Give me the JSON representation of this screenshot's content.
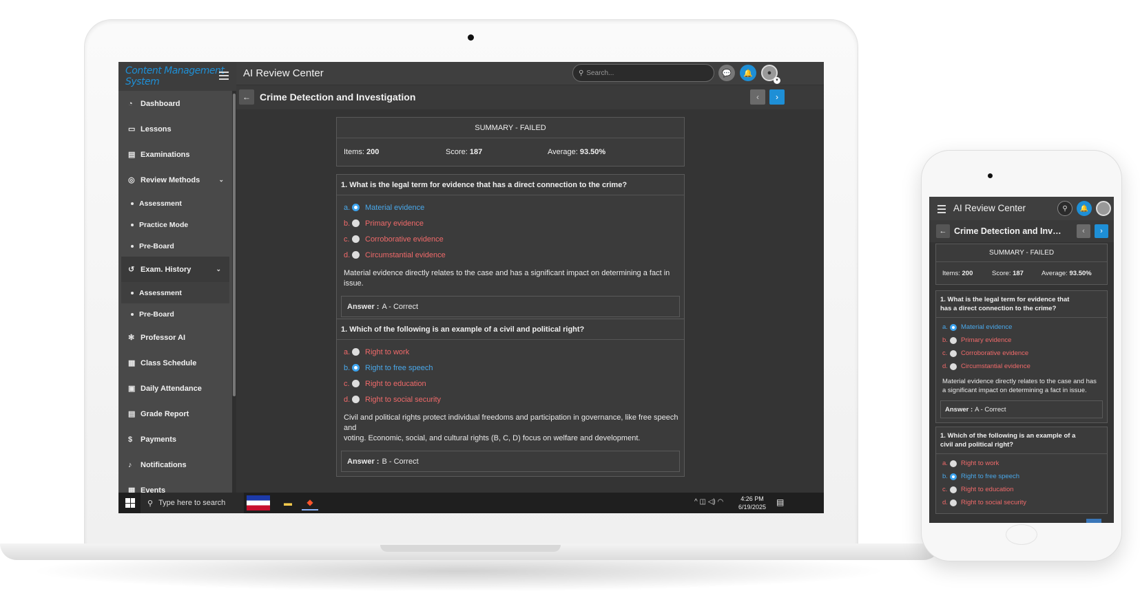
{
  "app": {
    "brand": "Content Management System",
    "title": "AI Review Center",
    "page_title": "Crime Detection and Investigation",
    "page_title_short": "Crime Detection and Invest...",
    "search_placeholder": "Search..."
  },
  "sidebar": {
    "items": [
      {
        "label": "Dashboard",
        "icon": "dashboard-icon"
      },
      {
        "label": "Lessons",
        "icon": "folder-icon"
      },
      {
        "label": "Examinations",
        "icon": "document-icon"
      },
      {
        "label": "Review Methods",
        "icon": "check-circle-icon"
      },
      {
        "label": "Exam. History",
        "icon": "history-icon"
      },
      {
        "label": "Professor AI",
        "icon": "snowflake-icon"
      },
      {
        "label": "Class Schedule",
        "icon": "calendar-icon"
      },
      {
        "label": "Daily Attendance",
        "icon": "calendar-check-icon"
      },
      {
        "label": "Grade Report",
        "icon": "report-icon"
      },
      {
        "label": "Payments",
        "icon": "dollar-icon"
      },
      {
        "label": "Notifications",
        "icon": "bell-icon"
      },
      {
        "label": "Events",
        "icon": "calendar-icon"
      }
    ],
    "review_methods_sub": [
      "Assessment",
      "Practice Mode",
      "Pre-Board"
    ],
    "exam_history_sub": [
      "Assessment",
      "Pre-Board"
    ]
  },
  "summary": {
    "heading": "SUMMARY - FAILED",
    "items_label": "Items:",
    "items_value": "200",
    "score_label": "Score:",
    "score_value": "187",
    "average_label": "Average:",
    "average_value": "93.50%"
  },
  "questions": [
    {
      "text": "1. What is the legal term for evidence that has a direct connection to the crime?",
      "text_phone_1": "1. What is the legal term for evidence that",
      "text_phone_2": "has a direct connection to the crime?",
      "options": [
        {
          "letter": "a.",
          "label": "Material evidence"
        },
        {
          "letter": "b.",
          "label": "Primary evidence"
        },
        {
          "letter": "c.",
          "label": "Corroborative evidence"
        },
        {
          "letter": "d.",
          "label": "Circumstantial evidence"
        }
      ],
      "explanation": "Material evidence directly relates to the case and has a significant impact on determining a fact in issue.",
      "explanation_phone_1": "Material evidence directly relates to the case and has",
      "explanation_phone_2": "a significant impact on determining a fact in issue.",
      "answer_label": "Answer :",
      "answer_value": "A - Correct"
    },
    {
      "text": "1. Which of the following is an example of a civil and political right?",
      "text_phone_1": "1. Which of the following is an example of a",
      "text_phone_2": "civil and political right?",
      "options": [
        {
          "letter": "a.",
          "label": "Right to work"
        },
        {
          "letter": "b.",
          "label": "Right to free speech"
        },
        {
          "letter": "c.",
          "label": "Right to education"
        },
        {
          "letter": "d.",
          "label": "Right to social security"
        }
      ],
      "explanation_1": "Civil and political rights protect individual freedoms and participation in governance, like free speech and",
      "explanation_2": "voting. Economic, social, and cultural rights (B, C, D) focus on welfare and development.",
      "answer_label": "Answer :",
      "answer_value": "B - Correct"
    }
  ],
  "taskbar": {
    "search_placeholder": "Type here to search",
    "time": "4:26 PM",
    "date": "6/19/2025"
  },
  "colors": {
    "accent": "#1e8fd6",
    "correct": "#4aa8ea",
    "wrong": "#f06a6a"
  }
}
